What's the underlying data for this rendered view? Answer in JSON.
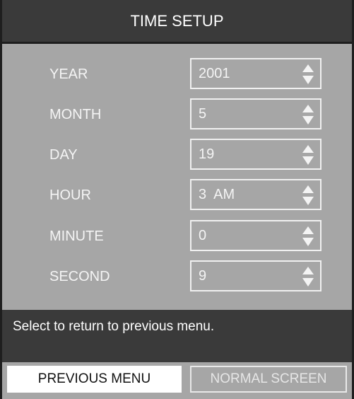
{
  "title": "TIME SETUP",
  "fields": [
    {
      "label": "YEAR",
      "value": "2001"
    },
    {
      "label": "MONTH",
      "value": "5"
    },
    {
      "label": "DAY",
      "value": "19"
    },
    {
      "label": "HOUR",
      "value": "3  AM"
    },
    {
      "label": "MINUTE",
      "value": "0"
    },
    {
      "label": "SECOND",
      "value": "9"
    }
  ],
  "status_message": "Select to return to previous menu.",
  "buttons": {
    "previous_menu": "PREVIOUS MENU",
    "normal_screen": "NORMAL SCREEN"
  },
  "icons": {
    "spinner": "up-down-spinner-icon"
  },
  "colors": {
    "panel_bg": "#a6a6a6",
    "title_bg": "#3a3a3a",
    "status_bg": "#3a3a3a",
    "text_light": "#f4f4f4",
    "selected_button_bg": "#ffffff"
  }
}
